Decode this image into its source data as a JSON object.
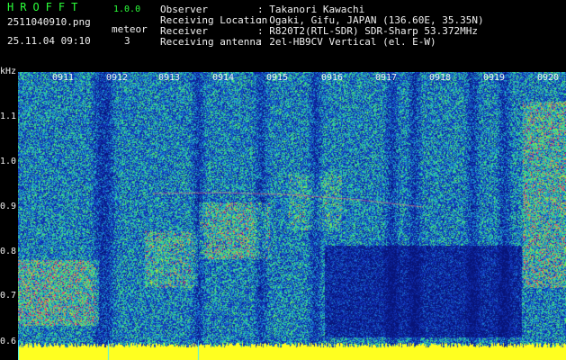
{
  "header": {
    "app_name": "HROFFT",
    "version": "1.0.0",
    "filename": "2511040910.png",
    "meteor_label": "meteor",
    "datetime": "25.11.04 09:10",
    "meteor_count": "3"
  },
  "info": [
    {
      "key": "Observer",
      "value": ": Takanori Kawachi"
    },
    {
      "key": "Receiving Location",
      "value": ": Ogaki, Gifu, JAPAN (136.60E, 35.35N)"
    },
    {
      "key": "Receiver",
      "value": ": R820T2(RTL-SDR) SDR-Sharp 53.372MHz"
    },
    {
      "key": "Receiving antenna",
      "value": ": 2el-HB9CV Vertical (el. E-W)"
    }
  ],
  "spectrogram": {
    "unit": "kHz",
    "time_labels": [
      "0911",
      "0912",
      "0913",
      "0914",
      "0915",
      "0916",
      "0917",
      "0918",
      "0919",
      "0920"
    ],
    "freq_labels": [
      "1.1",
      "1.0",
      "0.9",
      "0.8",
      "0.7",
      "0.6"
    ],
    "freq_range_khz": [
      0.58,
      1.18
    ],
    "time_range_min": [
      0,
      10
    ],
    "colors": {
      "noise_low": "#1030a8",
      "noise_mid": "#20a0c0",
      "signal_mid": "#40e060",
      "signal_high": "#ff2070",
      "baseline": "#ffff20"
    }
  }
}
